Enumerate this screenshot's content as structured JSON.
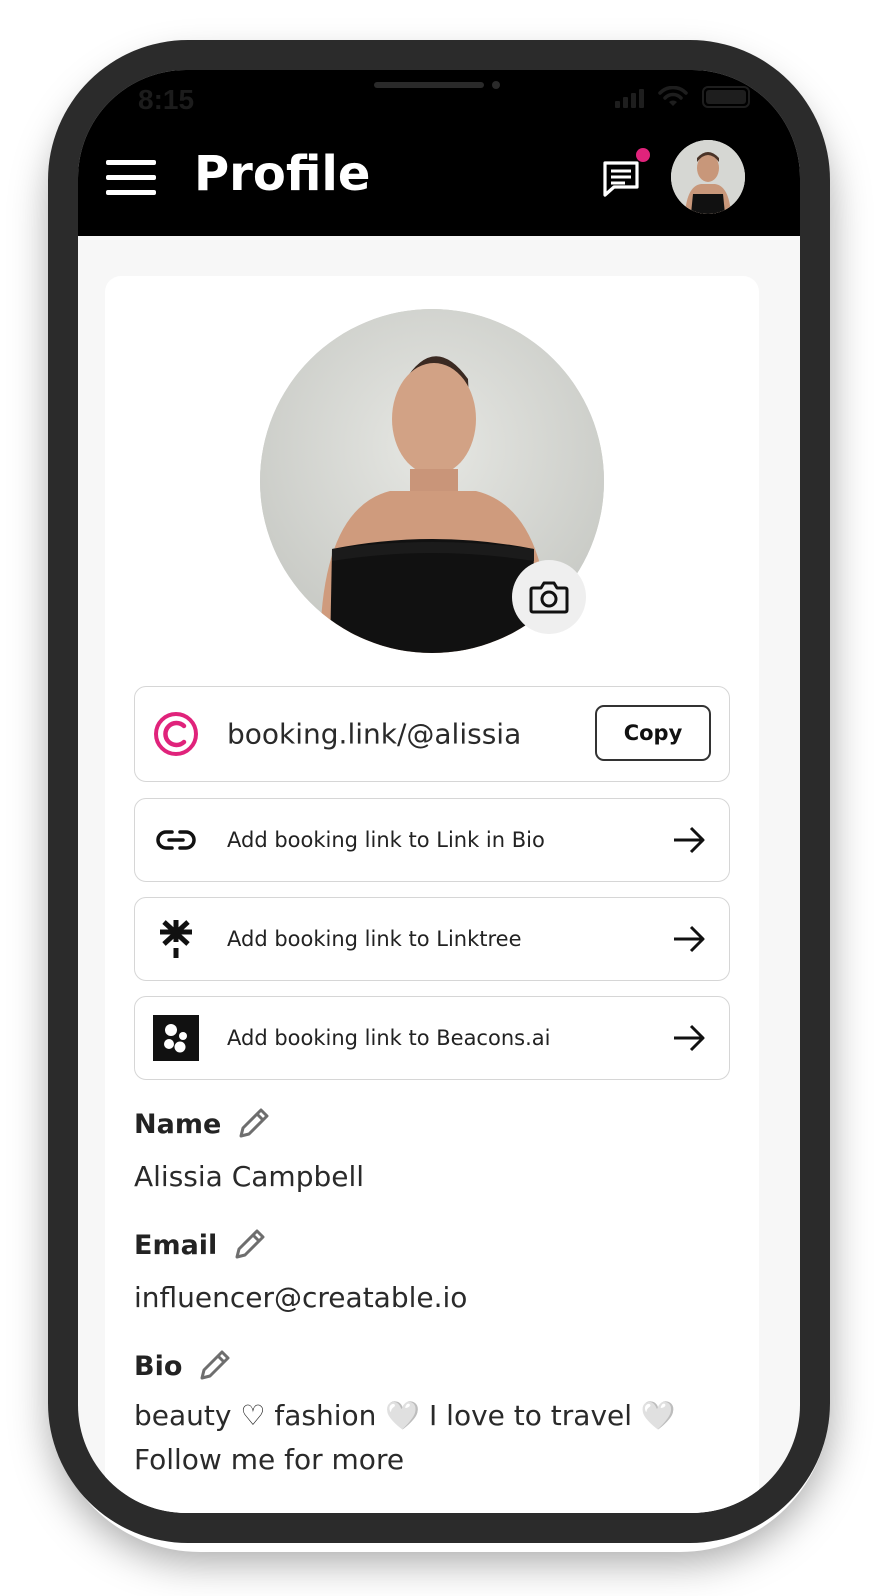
{
  "status_bar": {
    "time": "8:15"
  },
  "header": {
    "title": "Profile"
  },
  "booking": {
    "url": "booking.link/@alissia",
    "copy_label": "Copy"
  },
  "link_actions": [
    {
      "label": "Add booking link to Link in Bio",
      "icon": "chain-link-icon"
    },
    {
      "label": "Add booking link to Linktree",
      "icon": "linktree-icon"
    },
    {
      "label": "Add booking link to Beacons.ai",
      "icon": "beacons-icon"
    }
  ],
  "fields": {
    "name": {
      "label": "Name",
      "value": "Alissia Campbell"
    },
    "email": {
      "label": "Email",
      "value": "influencer@creatable.io"
    },
    "bio": {
      "label": "Bio",
      "line1": "beauty ♡ fashion 🤍 I love to travel 🤍",
      "line2": "Follow me for more"
    }
  },
  "colors": {
    "brand_pink": "#e0237b",
    "header_bg": "#000000",
    "page_bg": "#f7f7f7"
  }
}
